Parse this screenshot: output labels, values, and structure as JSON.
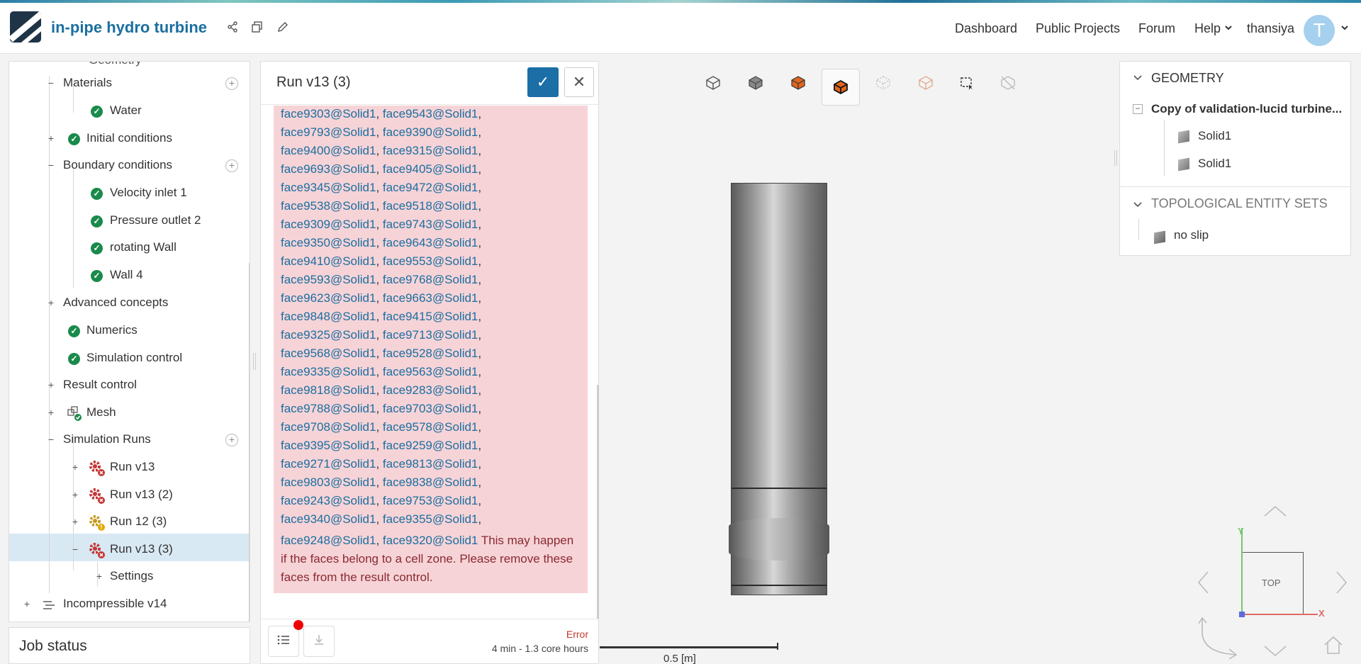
{
  "header": {
    "project_title": "in-pipe hydro turbine",
    "nav": [
      "Dashboard",
      "Public Projects",
      "Forum",
      "Help"
    ],
    "username": "thansiya",
    "avatar_letter": "T"
  },
  "tree": {
    "partial_top": "Geometry",
    "materials": "Materials",
    "water": "Water",
    "initial_conditions": "Initial conditions",
    "boundary_conditions": "Boundary conditions",
    "velocity_inlet": "Velocity inlet 1",
    "pressure_outlet": "Pressure outlet 2",
    "rotating_wall": "rotating Wall",
    "wall4": "Wall 4",
    "advanced_concepts": "Advanced concepts",
    "numerics": "Numerics",
    "simulation_control": "Simulation control",
    "result_control": "Result control",
    "mesh": "Mesh",
    "simulation_runs": "Simulation Runs",
    "run1": "Run v13",
    "run2": "Run v13 (2)",
    "run3": "Run 12 (3)",
    "run4": "Run v13 (3)",
    "settings": "Settings",
    "incompressible": "Incompressible v14"
  },
  "job_status": {
    "title": "Job status"
  },
  "dialog": {
    "title": "Run v13 (3)",
    "face_pairs": [
      [
        "face9303@Solid1",
        "face9543@Solid1"
      ],
      [
        "face9793@Solid1",
        "face9390@Solid1"
      ],
      [
        "face9400@Solid1",
        "face9315@Solid1"
      ],
      [
        "face9693@Solid1",
        "face9405@Solid1"
      ],
      [
        "face9345@Solid1",
        "face9472@Solid1"
      ],
      [
        "face9538@Solid1",
        "face9518@Solid1"
      ],
      [
        "face9309@Solid1",
        "face9743@Solid1"
      ],
      [
        "face9350@Solid1",
        "face9643@Solid1"
      ],
      [
        "face9410@Solid1",
        "face9553@Solid1"
      ],
      [
        "face9593@Solid1",
        "face9768@Solid1"
      ],
      [
        "face9623@Solid1",
        "face9663@Solid1"
      ],
      [
        "face9848@Solid1",
        "face9415@Solid1"
      ],
      [
        "face9325@Solid1",
        "face9713@Solid1"
      ],
      [
        "face9568@Solid1",
        "face9528@Solid1"
      ],
      [
        "face9335@Solid1",
        "face9563@Solid1"
      ],
      [
        "face9818@Solid1",
        "face9283@Solid1"
      ],
      [
        "face9788@Solid1",
        "face9703@Solid1"
      ],
      [
        "face9708@Solid1",
        "face9578@Solid1"
      ],
      [
        "face9395@Solid1",
        "face9259@Solid1"
      ],
      [
        "face9271@Solid1",
        "face9813@Solid1"
      ],
      [
        "face9803@Solid1",
        "face9838@Solid1"
      ],
      [
        "face9243@Solid1",
        "face9753@Solid1"
      ],
      [
        "face9340@Solid1",
        "face9355@Solid1"
      ]
    ],
    "last_pair": [
      "face9248@Solid1",
      "face9320@Solid1"
    ],
    "msg_line1": " This may happen",
    "msg_line2": "if the faces belong to a cell zone. Please remove these",
    "msg_line3": "faces from the result control.",
    "status": "Error",
    "time": "4 min - 1.3 core hours"
  },
  "geometry_panel": {
    "title": "GEOMETRY",
    "model": "Copy of validation-lucid turbine...",
    "solids": [
      "Solid1",
      "Solid1"
    ],
    "entity_sets_title": "TOPOLOGICAL ENTITY SETS",
    "entity_set": "no slip"
  },
  "viewer": {
    "scale_label": "0.5 [m]",
    "view_label": "TOP",
    "axis_x": "X",
    "axis_y": "Y"
  },
  "colors": {
    "brand": "#1a6fa0",
    "error_bg": "#f6d3d7",
    "check_green": "#1a8a4a",
    "primary_button": "#1b6fa6"
  }
}
